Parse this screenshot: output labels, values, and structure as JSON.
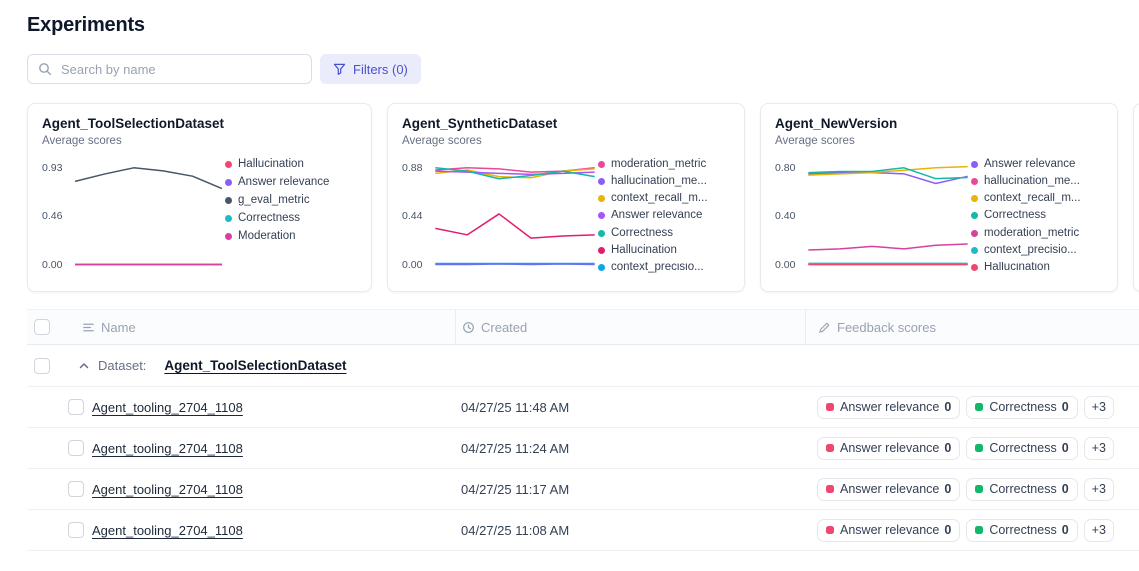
{
  "page": {
    "title": "Experiments"
  },
  "toolbar": {
    "search_placeholder": "Search by name",
    "filters_label": "Filters (0)"
  },
  "cards": [
    {
      "title": "Agent_ToolSelectionDataset",
      "subtitle": "Average scores",
      "chart": {
        "type": "line",
        "y_ticks": [
          "0.93",
          "0.46",
          "0.00"
        ],
        "ylim": [
          0,
          0.93
        ],
        "series": [
          {
            "name": "Hallucination",
            "color": "#ef476f",
            "values": [
              0,
              0,
              0,
              0,
              0,
              0
            ]
          },
          {
            "name": "Answer relevance",
            "color": "#8b5cf6",
            "values": [
              0,
              0,
              0,
              0,
              0,
              0
            ]
          },
          {
            "name": "g_eval_metric",
            "color": "#475569",
            "values": [
              0.8,
              0.87,
              0.93,
              0.9,
              0.85,
              0.73
            ]
          },
          {
            "name": "Correctness",
            "color": "#22b8c9",
            "values": [
              0,
              0,
              0,
              0,
              0,
              0
            ]
          },
          {
            "name": "Moderation",
            "color": "#d6409f",
            "values": [
              0,
              0,
              0,
              0,
              0,
              0
            ]
          }
        ]
      }
    },
    {
      "title": "Agent_SyntheticDataset",
      "subtitle": "Average scores",
      "chart": {
        "type": "line",
        "y_ticks": [
          "0.88",
          "0.44",
          "0.00"
        ],
        "ylim": [
          0,
          0.88
        ],
        "series": [
          {
            "name": "moderation_metric",
            "color": "#ec4899",
            "values": [
              0.86,
              0.88,
              0.87,
              0.84,
              0.85,
              0.88
            ]
          },
          {
            "name": "hallucination_me...",
            "color": "#8b5cf6",
            "values": [
              0,
              0,
              0.005,
              0,
              0.005,
              0
            ]
          },
          {
            "name": "context_recall_m...",
            "color": "#eab308",
            "values": [
              0.83,
              0.86,
              0.8,
              0.79,
              0.85,
              0.87
            ]
          },
          {
            "name": "Answer relevance",
            "color": "#a855f7",
            "values": [
              0.85,
              0.84,
              0.83,
              0.82,
              0.83,
              0.84
            ]
          },
          {
            "name": "Correctness",
            "color": "#14b8a6",
            "values": [
              0.88,
              0.85,
              0.78,
              0.81,
              0.85,
              0.8
            ]
          },
          {
            "name": "Hallucination",
            "color": "#e11d6f",
            "values": [
              0.33,
              0.27,
              0.46,
              0.24,
              0.26,
              0.27
            ]
          },
          {
            "name": "context_precisio...",
            "color": "#0ea5e9",
            "values": [
              0.01,
              0.01,
              0.01,
              0.01,
              0.01,
              0.01
            ]
          }
        ]
      }
    },
    {
      "title": "Agent_NewVersion",
      "subtitle": "Average scores",
      "chart": {
        "type": "line",
        "y_ticks": [
          "0.80",
          "0.40",
          "0.00"
        ],
        "ylim": [
          0,
          0.8
        ],
        "series": [
          {
            "name": "Answer relevance",
            "color": "#8b5cf6",
            "values": [
              0.75,
              0.76,
              0.76,
              0.75,
              0.67,
              0.73
            ]
          },
          {
            "name": "hallucination_me...",
            "color": "#ec4899",
            "values": [
              0,
              0,
              0,
              0,
              0,
              0
            ]
          },
          {
            "name": "context_recall_m...",
            "color": "#eab308",
            "values": [
              0.74,
              0.75,
              0.76,
              0.78,
              0.8,
              0.81
            ]
          },
          {
            "name": "Correctness",
            "color": "#14b8a6",
            "values": [
              0.76,
              0.77,
              0.77,
              0.8,
              0.71,
              0.72
            ]
          },
          {
            "name": "moderation_metric",
            "color": "#d6409f",
            "values": [
              0.12,
              0.13,
              0.15,
              0.13,
              0.16,
              0.17
            ]
          },
          {
            "name": "context_precisio...",
            "color": "#22b8c9",
            "values": [
              0.01,
              0.01,
              0.01,
              0.01,
              0.01,
              0.01
            ]
          },
          {
            "name": "Hallucination",
            "color": "#ef476f",
            "values": [
              0,
              0,
              0,
              0,
              0,
              0
            ]
          }
        ]
      }
    }
  ],
  "table": {
    "columns": [
      {
        "label": "Name"
      },
      {
        "label": "Created"
      },
      {
        "label": "Feedback scores"
      }
    ],
    "group": {
      "prefix": "Dataset:",
      "dataset": "Agent_ToolSelectionDataset"
    },
    "rows": [
      {
        "name": "Agent_tooling_2704_1108",
        "created": "04/27/25 11:48 AM",
        "feedback": [
          {
            "label": "Answer relevance",
            "value": "0",
            "color": "#ef476f"
          },
          {
            "label": "Correctness",
            "value": "0",
            "color": "#12b76a"
          }
        ],
        "more": "+3"
      },
      {
        "name": "Agent_tooling_2704_1108",
        "created": "04/27/25 11:24 AM",
        "feedback": [
          {
            "label": "Answer relevance",
            "value": "0",
            "color": "#ef476f"
          },
          {
            "label": "Correctness",
            "value": "0",
            "color": "#12b76a"
          }
        ],
        "more": "+3"
      },
      {
        "name": "Agent_tooling_2704_1108",
        "created": "04/27/25 11:17 AM",
        "feedback": [
          {
            "label": "Answer relevance",
            "value": "0",
            "color": "#ef476f"
          },
          {
            "label": "Correctness",
            "value": "0",
            "color": "#12b76a"
          }
        ],
        "more": "+3"
      },
      {
        "name": "Agent_tooling_2704_1108",
        "created": "04/27/25 11:08 AM",
        "feedback": [
          {
            "label": "Answer relevance",
            "value": "0",
            "color": "#ef476f"
          },
          {
            "label": "Correctness",
            "value": "0",
            "color": "#12b76a"
          }
        ],
        "more": "+3"
      }
    ]
  }
}
